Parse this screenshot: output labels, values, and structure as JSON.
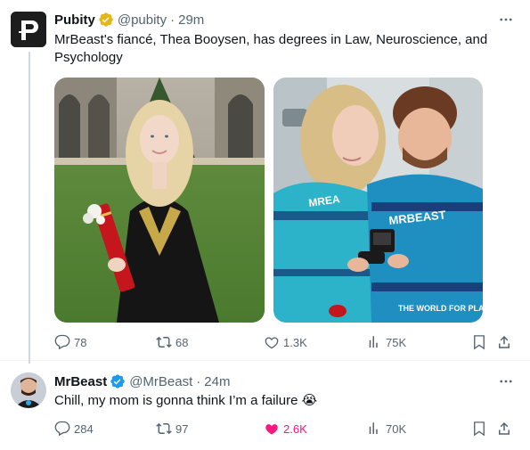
{
  "tweet1": {
    "author_name": "Pubity",
    "handle": "@pubity",
    "separator": "·",
    "time": "29m",
    "text": "MrBeast's fiancé, Thea Booysen, has degrees in Law, Neuroscience, and Psychology",
    "verified_badge": "gold-verified",
    "replies": "78",
    "reposts": "68",
    "likes": "1.3K",
    "views": "75K",
    "photo2_text": {
      "sweater_left": "MREA",
      "sweater_right": "MRBEAST",
      "sweater_bottom": "THE WORLD FOR PLACE"
    }
  },
  "tweet2": {
    "author_name": "MrBeast",
    "handle": "@MrBeast",
    "separator": "·",
    "time": "24m",
    "text": "Chill, my mom is gonna think I’m a failure 😭",
    "verified_badge": "blue-verified",
    "replies": "284",
    "reposts": "97",
    "likes": "2.6K",
    "likes_color": "#f91880",
    "views": "70K"
  },
  "colors": {
    "text": "#0f1419",
    "muted": "#536471",
    "gold": "#e2b719",
    "blue": "#1d9bf0",
    "pink": "#f91880"
  }
}
